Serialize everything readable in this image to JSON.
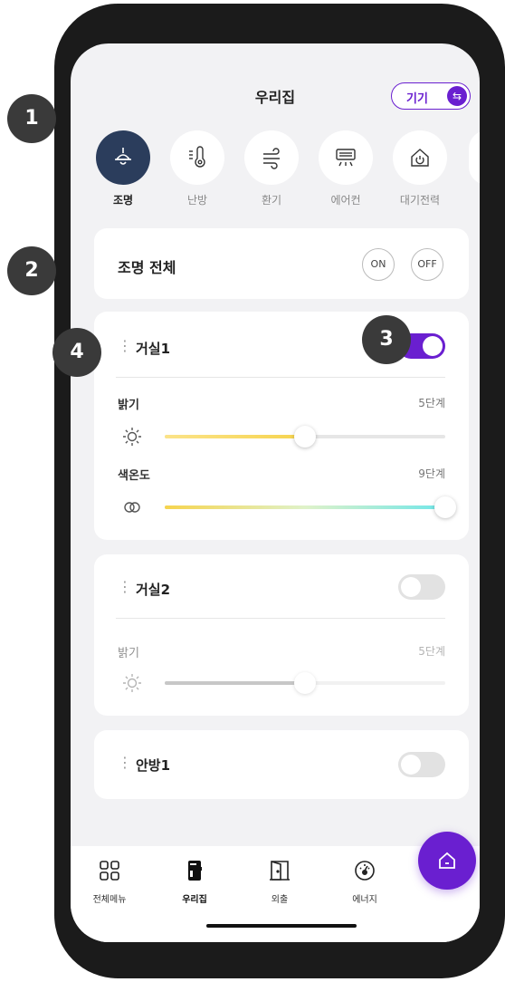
{
  "header": {
    "title": "우리집",
    "device_label": "기기",
    "swap_glyph": "⇆"
  },
  "categories": [
    {
      "label": "조명",
      "icon": "ceiling-lamp-icon",
      "active": true
    },
    {
      "label": "난방",
      "icon": "thermometer-icon",
      "active": false
    },
    {
      "label": "환기",
      "icon": "wind-icon",
      "active": false
    },
    {
      "label": "에어컨",
      "icon": "air-conditioner-icon",
      "active": false
    },
    {
      "label": "대기전력",
      "icon": "standby-power-icon",
      "active": false
    }
  ],
  "all_lights": {
    "title": "조명 전체",
    "on_label": "ON",
    "off_label": "OFF"
  },
  "rooms": [
    {
      "name": "거실1",
      "on": true,
      "brightness": {
        "label": "밝기",
        "value": "5단계",
        "level": 0.5
      },
      "color_temp": {
        "label": "색온도",
        "value": "9단계",
        "level": 1.0
      }
    },
    {
      "name": "거실2",
      "on": false,
      "brightness": {
        "label": "밝기",
        "value": "5단계",
        "level": 0.5
      }
    },
    {
      "name": "안방1",
      "on": false
    }
  ],
  "bottom_nav": [
    {
      "label": "전체메뉴",
      "icon": "grid-menu-icon"
    },
    {
      "label": "우리집",
      "icon": "door-lock-icon"
    },
    {
      "label": "외출",
      "icon": "door-icon"
    },
    {
      "label": "에너지",
      "icon": "gauge-icon"
    }
  ],
  "fab": {
    "icon": "home-icon"
  },
  "callouts": [
    "1",
    "2",
    "3",
    "4"
  ],
  "colors": {
    "accent": "#6a1fd0",
    "active_category": "#2b3d5c",
    "brightness_fill": "#f8d55a",
    "callout": "#3a3a3a"
  }
}
